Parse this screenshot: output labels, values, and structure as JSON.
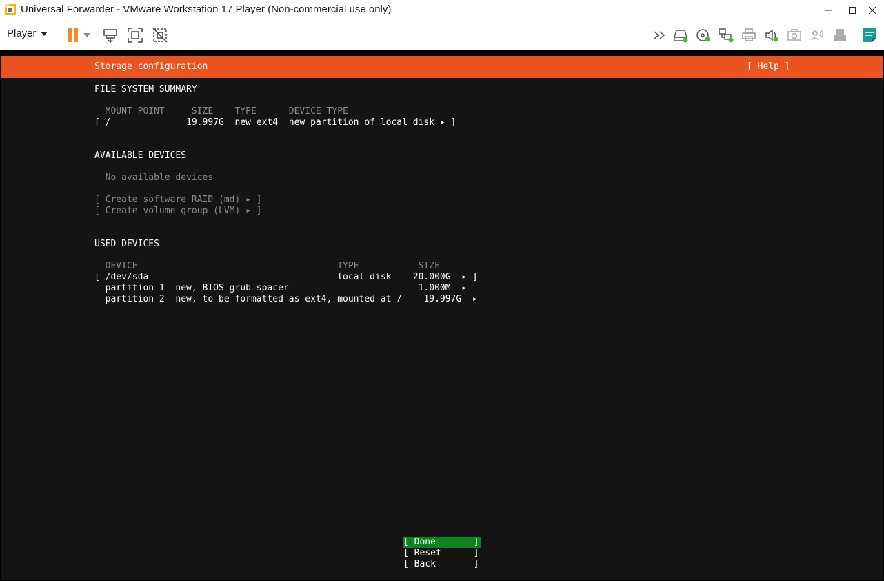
{
  "window": {
    "title": "Universal Forwarder - VMware Workstation 17 Player (Non-commercial use only)"
  },
  "toolbar": {
    "player_label": "Player",
    "icons": [
      "pause-icon",
      "dropdown-arrow-icon",
      "send-ctrl-alt-del-icon",
      "fullscreen-icon",
      "unity-icon",
      "chevron-right-icon",
      "hard-disk-icon",
      "cd-dvd-icon",
      "network-adapter-icon",
      "printer-icon",
      "sound-card-icon",
      "camera-icon",
      "bluetooth-icon",
      "usb-device-icon",
      "notes-icon"
    ]
  },
  "colors": {
    "accent_orange": "#e95420",
    "console_bg": "#141414",
    "done_green": "#0e8420",
    "pause_orange": "#f28c28"
  },
  "installer": {
    "header_title": "Storage configuration",
    "help": "[ Help ]",
    "fs_summary": {
      "heading": "FILE SYSTEM SUMMARY",
      "columns": "  MOUNT POINT     SIZE    TYPE      DEVICE TYPE",
      "row": "[ /              19.997G  new ext4  new partition of local disk ▸ ]"
    },
    "available": {
      "heading": "AVAILABLE DEVICES",
      "none": "  No available devices",
      "raid": "[ Create software RAID (md) ▸ ]",
      "lvm": "[ Create volume group (LVM) ▸ ]"
    },
    "used": {
      "heading": "USED DEVICES",
      "columns": "  DEVICE                                     TYPE           SIZE",
      "rows": [
        "[ /dev/sda                                   local disk    20.000G  ▸ ]",
        "  partition 1  new, BIOS grub spacer                        1.000M  ▸",
        "  partition 2  new, to be formatted as ext4, mounted at /    19.997G  ▸"
      ]
    },
    "buttons": {
      "done": "[ Done       ]",
      "reset": "[ Reset      ]",
      "back": "[ Back       ]"
    }
  }
}
